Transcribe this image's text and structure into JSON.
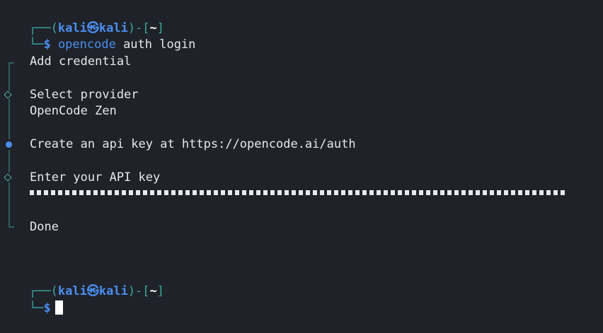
{
  "prompt1": {
    "user": "kali",
    "host": "kali",
    "dir": "~",
    "symbol": "$",
    "command_name": "opencode",
    "command_args": " auth login"
  },
  "steps": {
    "title": "Add credential",
    "select_provider_label": "Select provider",
    "select_provider_value": "OpenCode Zen",
    "create_key_text": "Create an api key at https://opencode.ai/auth",
    "enter_key_label": "Enter your API key",
    "masked_key_length": 76,
    "done_label": "Done"
  },
  "prompt2": {
    "user": "kali",
    "host": "kali",
    "dir": "~",
    "symbol": "$"
  },
  "icons": {
    "skull": "kali-skull-icon",
    "diamond": "diamond-step-icon",
    "active": "active-step-dot-icon"
  },
  "colors": {
    "background": "#1f2229",
    "prompt_teal": "#3aa7a0",
    "prompt_blue": "#4a8ff0",
    "text": "#e6e8ec"
  }
}
